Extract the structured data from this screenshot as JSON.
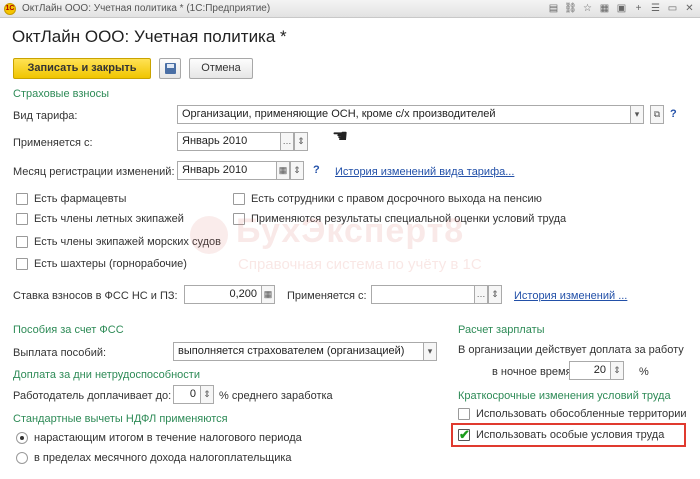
{
  "window": {
    "title": "ОктЛайн ООО: Учетная политика * (1С:Предприятие)",
    "app_icon_label": "1С"
  },
  "document": {
    "title": "ОктЛайн ООО: Учетная политика *"
  },
  "toolbar": {
    "save_close_label": "Записать и закрыть",
    "cancel_label": "Отмена"
  },
  "insurance": {
    "section_title": "Страховые взносы",
    "tariff_label": "Вид тарифа:",
    "tariff_value": "Организации, применяющие ОСН, кроме с/х производителей",
    "applied_from_label": "Применяется с:",
    "applied_from_value": "Январь 2010",
    "reg_month_label": "Месяц регистрации изменений:",
    "reg_month_value": "Январь 2010",
    "tariff_history_link": "История изменений вида тарифа...",
    "checkboxes_left": [
      {
        "label": "Есть фармацевты",
        "checked": false
      },
      {
        "label": "Есть члены летных экипажей",
        "checked": false
      },
      {
        "label": "Есть члены экипажей морских судов",
        "checked": false
      },
      {
        "label": "Есть шахтеры (горнорабочие)",
        "checked": false
      }
    ],
    "checkboxes_right": [
      {
        "label": "Есть сотрудники с правом досрочного выхода на пенсию",
        "checked": false
      },
      {
        "label": "Применяются результаты специальной оценки условий труда",
        "checked": false
      }
    ],
    "fss_rate_label": "Ставка взносов в ФСС НС и ПЗ:",
    "fss_rate_value": "0,200",
    "fss_applied_label": "Применяется с:",
    "fss_applied_value": "",
    "fss_history_link": "История изменений ..."
  },
  "fss_benefits": {
    "section_title": "Пособия за счет ФСС",
    "payment_label": "Выплата пособий:",
    "payment_value": "выполняется страхователем (организацией)"
  },
  "sick_days": {
    "section_title": "Доплата за дни нетрудоспособности",
    "employer_pays_label": "Работодатель доплачивает до:",
    "employer_pays_value": "0",
    "suffix": "% среднего заработка"
  },
  "ndfl": {
    "section_title": "Стандартные вычеты НДФЛ применяются",
    "options": [
      {
        "label": "нарастающим итогом в течение налогового периода",
        "selected": true
      },
      {
        "label": "в пределах месячного дохода налогоплательщика",
        "selected": false
      }
    ]
  },
  "salary": {
    "section_title": "Расчет зарплаты",
    "night_text": "В организации действует доплата за работу",
    "night_label": "в ночное время:",
    "night_value": "20",
    "percent": "%"
  },
  "short_term": {
    "section_title": "Краткосрочные изменения условий труда",
    "options": [
      {
        "label": "Использовать обособленные территории",
        "checked": false
      },
      {
        "label": "Использовать особые условия труда",
        "checked": true
      }
    ]
  },
  "watermark": {
    "big": "БухЭксперт8",
    "small": "Справочная система по учёту в 1С"
  },
  "colors": {
    "section_green": "#2e8b57",
    "link_blue": "#2250a8",
    "primary_yellow": "#f0c500",
    "highlight_red": "#e03a2f"
  }
}
